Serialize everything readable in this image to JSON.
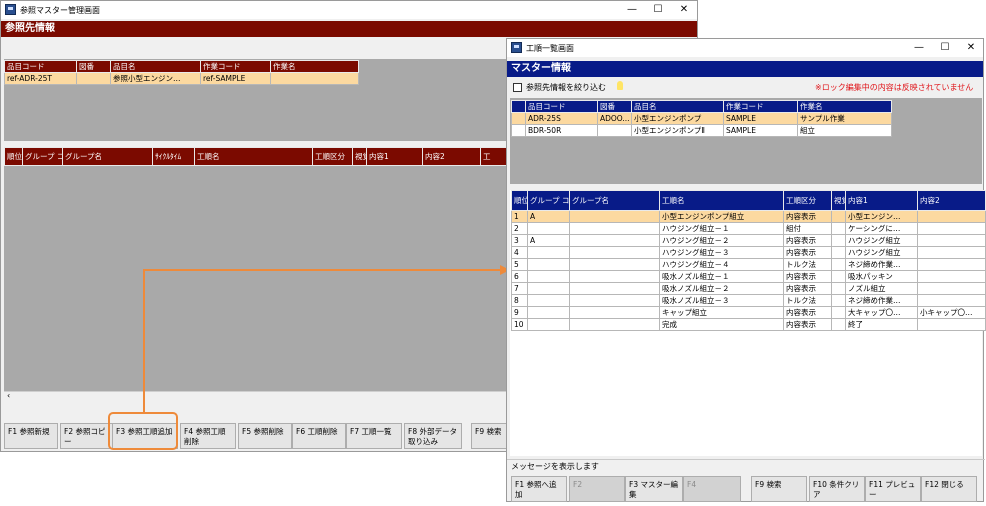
{
  "colors": {
    "main_banner": "#7b0a00",
    "sub_banner": "#081b88",
    "selected_row": "#fcd9a0",
    "highlight_orange": "#ee8a3a"
  },
  "main": {
    "title": "参照マスター管理画面",
    "banner": "参照先情報",
    "items_headers": [
      "品目コード",
      "図番",
      "品目名",
      "作業コード",
      "作業名"
    ],
    "items_rows": [
      [
        "ref-ADR-25T",
        "",
        "参照小型エンジン…",
        "ref-SAMPLE",
        ""
      ]
    ],
    "steps_headers": [
      "順位",
      "グループ コード",
      "グループ名",
      "ｻｲｸﾙﾀｲﾑ",
      "工順名",
      "工順区分",
      "視覚",
      "内容1",
      "内容2",
      "工"
    ],
    "fkeys": [
      "F1 参照新規",
      "F2 参照コピー",
      "F3 参照工順追加",
      "F4 参照工順削除",
      "F5 参照削除",
      "F6 工順削除",
      "F7 工順一覧",
      "F8 外部データ取り込み",
      "F9 検索"
    ]
  },
  "sub": {
    "title": "工順一覧画面",
    "banner": "マスター情報",
    "filter_label": "参照先情報を絞り込む",
    "lock_note": "※ロック編集中の内容は反映されていません",
    "items_headers": [
      "品目コード",
      "図番",
      "品目名",
      "作業コード",
      "作業名"
    ],
    "items_rows": [
      [
        "ADR-25S",
        "ADOO...",
        "小型エンジンポンプ",
        "SAMPLE",
        "サンプル作業"
      ],
      [
        "BDR-50R",
        "",
        "小型エンジンポンプⅡ",
        "SAMPLE",
        "組立"
      ]
    ],
    "steps_headers": [
      "順位",
      "グループ コード",
      "グループ名",
      "工順名",
      "工順区分",
      "視覚",
      "内容1",
      "内容2"
    ],
    "steps_rows": [
      [
        "1",
        "A",
        "",
        "小型エンジンポンプ組立",
        "内容表示",
        "",
        "小型エンジン…",
        ""
      ],
      [
        "2",
        "",
        "",
        "ハウジング組立－１",
        "組付",
        "",
        "ケーシングに…",
        ""
      ],
      [
        "3",
        "A",
        "",
        "ハウジング組立－２",
        "内容表示",
        "",
        "ハウジング組立",
        ""
      ],
      [
        "4",
        "",
        "",
        "ハウジング組立－３",
        "内容表示",
        "",
        "ハウジング組立",
        ""
      ],
      [
        "5",
        "",
        "",
        "ハウジング組立－４",
        "トルク法",
        "",
        "ネジ締め作業…",
        ""
      ],
      [
        "6",
        "",
        "",
        "吸水ノズル組立－１",
        "内容表示",
        "",
        "吸水パッキン",
        ""
      ],
      [
        "7",
        "",
        "",
        "吸水ノズル組立－２",
        "内容表示",
        "",
        "ノズル組立",
        ""
      ],
      [
        "8",
        "",
        "",
        "吸水ノズル組立－３",
        "トルク法",
        "",
        "ネジ締め作業…",
        ""
      ],
      [
        "9",
        "",
        "",
        "キャップ組立",
        "内容表示",
        "",
        "大キャップ〇…",
        "小キャップ〇…"
      ],
      [
        "10",
        "",
        "",
        "完成",
        "内容表示",
        "",
        "終了",
        ""
      ]
    ],
    "status": "メッセージを表示します",
    "fkeys": [
      "F1 参照へ追加",
      "F2",
      "F3 マスター編集",
      "F4",
      "F9 検索",
      "F10 条件クリア",
      "F11 プレビュー",
      "F12 閉じる"
    ]
  }
}
